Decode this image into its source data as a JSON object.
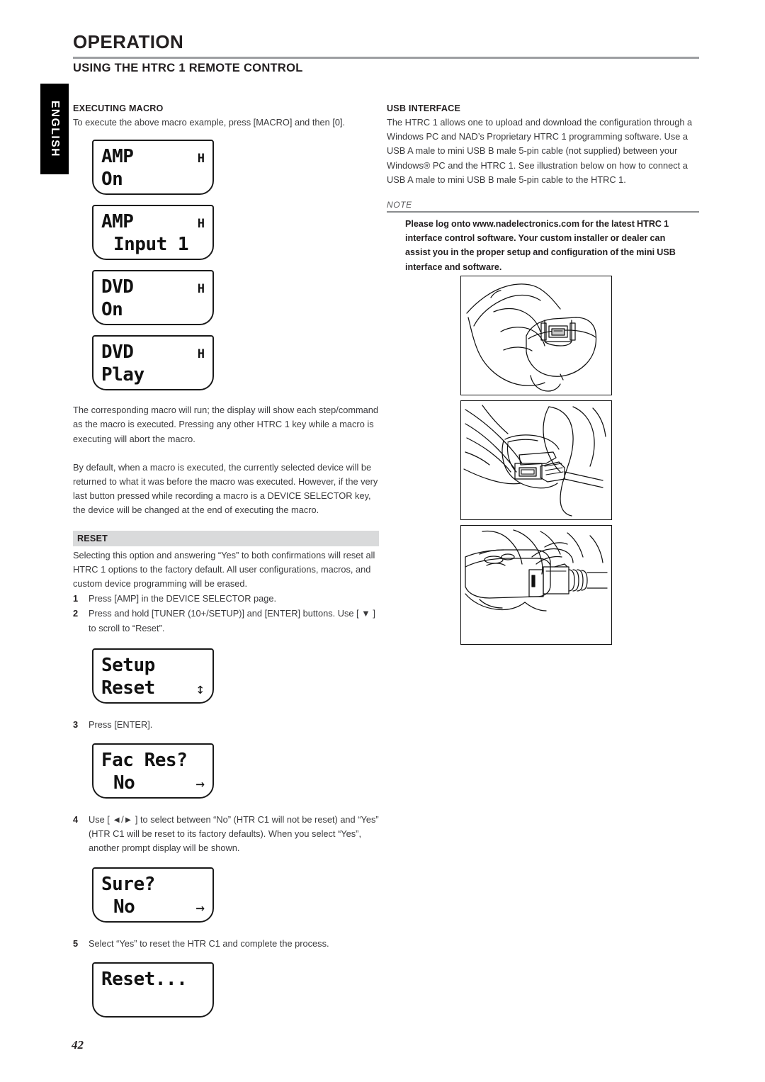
{
  "sidebar": {
    "language_tab": "ENGLISH"
  },
  "header": {
    "chapter_title": "OPERATION",
    "section_title": "USING THE HTRC 1 REMOTE CONTROL"
  },
  "left_column": {
    "executing_macro": {
      "heading": "EXECUTING MACRO",
      "intro": "To execute the above macro example, press [MACRO] and then [0].",
      "displays": [
        {
          "line1": "AMP",
          "indicator": "H",
          "line2": "On",
          "arrow": ""
        },
        {
          "line1": "AMP",
          "indicator": "H",
          "line2": "Input 1",
          "arrow": ""
        },
        {
          "line1": "DVD",
          "indicator": "H",
          "line2": "On",
          "arrow": ""
        },
        {
          "line1": "DVD",
          "indicator": "H",
          "line2": "Play",
          "arrow": ""
        }
      ],
      "para1": "The corresponding macro will run; the display will show each step/command as the macro is executed. Pressing any other HTRC 1 key while a macro is executing will abort the macro.",
      "para2": "By default, when a macro is executed, the currently selected device will be returned to what it was before the macro was executed. However, if the very last button pressed while recording a macro is a DEVICE SELECTOR key, the device will be changed at the end of executing the macro."
    },
    "reset": {
      "heading": "RESET",
      "intro": "Selecting this option and answering “Yes” to both confirmations will reset all HTRC 1 options to the factory default. All user configurations, macros, and custom device programming will be erased.",
      "steps": [
        {
          "num": "1",
          "text": "Press [AMP] in the DEVICE SELECTOR page."
        },
        {
          "num": "2",
          "text": "Press and hold [TUNER (10+/SETUP)] and [ENTER] buttons.  Use [ ▼ ] to scroll to “Reset”."
        },
        {
          "num": "3",
          "text": "Press [ENTER]."
        },
        {
          "num": "4",
          "text": "Use [ ◄/► ] to select between “No” (HTR C1 will not be reset) and “Yes” (HTR C1 will be reset to its factory defaults). When you select “Yes”, another prompt display will be shown."
        },
        {
          "num": "5",
          "text": "Select “Yes” to reset the HTR C1 and complete the process."
        }
      ],
      "display_setup": {
        "line1": "Setup",
        "line2": "Reset",
        "arrow": "↕"
      },
      "display_fac": {
        "line1": "Fac Res?",
        "line2": "No",
        "arrow": "→"
      },
      "display_sure": {
        "line1": "Sure?",
        "line2": "No",
        "arrow": "→"
      },
      "display_reset": {
        "line1": "Reset...",
        "line2": "",
        "arrow": ""
      }
    }
  },
  "right_column": {
    "usb_interface": {
      "heading": "USB INTERFACE",
      "body": "The HTRC 1 allows one to upload and download the configuration through a Windows PC and NAD’s Proprietary HTRC 1 programming software.  Use a USB A male to mini USB B male 5-pin cable (not supplied) between your Windows® PC and the HTRC 1. See illustration below on how to connect a USB A male to mini USB B male 5-pin cable to the HTRC 1."
    },
    "note": {
      "label": "NOTE",
      "text": "Please log onto www.nadelectronics.com for the latest HTRC 1 interface control software. Your custom installer or dealer can assist you in the proper setup and configuration of the mini USB interface and software."
    },
    "illustrations": [
      {
        "caption": "hand-holding-remote-rear"
      },
      {
        "caption": "opening-usb-port-cover"
      },
      {
        "caption": "inserting-usb-cable"
      }
    ]
  },
  "footer": {
    "page_number": "42"
  },
  "colors": {
    "rule": "#9d9fa2",
    "bar_head_bg": "#d9dadb",
    "tab_bg": "#000000",
    "text": "#231f20",
    "body_text": "#3a3a3c"
  }
}
